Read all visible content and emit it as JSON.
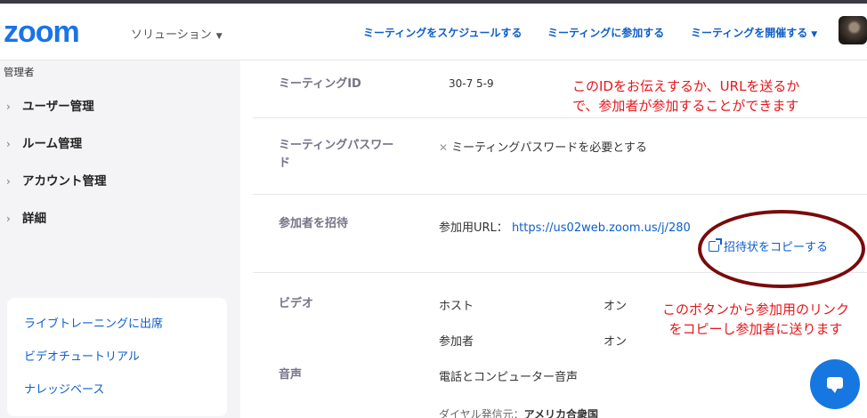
{
  "header": {
    "logo": "zoom",
    "solutions": "ソリューション",
    "nav": {
      "schedule": "ミーティングをスケジュールする",
      "join": "ミーティングに参加する",
      "host": "ミーティングを開催する"
    }
  },
  "sidebar": {
    "section_label": "管理者",
    "items": [
      {
        "label": "ユーザー管理"
      },
      {
        "label": "ルーム管理"
      },
      {
        "label": "アカウント管理"
      },
      {
        "label": "詳細"
      }
    ],
    "help_links": [
      {
        "label": "ライブトレーニングに出席"
      },
      {
        "label": "ビデオチュートリアル"
      },
      {
        "label": "ナレッジベース"
      }
    ]
  },
  "content": {
    "meeting_id": {
      "label": "ミーティングID",
      "value": "30-7 5-9"
    },
    "meeting_password": {
      "label_line1": "ミーティングパスワー",
      "label_line2": "ド",
      "value": "ミーティングパスワードを必要とする"
    },
    "invite": {
      "label": "参加者を招待",
      "url_label": "参加用URL：",
      "url": "https://us02web.zoom.us/j/280",
      "copy_label": "招待状をコピーする"
    },
    "video": {
      "label": "ビデオ",
      "host_label": "ホスト",
      "host_value": "オン",
      "participant_label": "参加者",
      "participant_value": "オン"
    },
    "audio": {
      "label": "音声",
      "value": "電話とコンピューター音声",
      "dial_label": "ダイヤル発信元：",
      "dial_value": "アメリカ合衆国"
    }
  },
  "annotations": {
    "top_line1": "このIDをお伝えするか、URLを送るか",
    "top_line2": "で、参加者が参加することができます",
    "bottom_line1": "このボタンから参加用のリンク",
    "bottom_line2": "をコピーし参加者に送ります"
  },
  "colors": {
    "brand": "#1a73e8",
    "link": "#0e5ec9",
    "annotation": "#e8161b",
    "ring": "#7a0b0b"
  }
}
